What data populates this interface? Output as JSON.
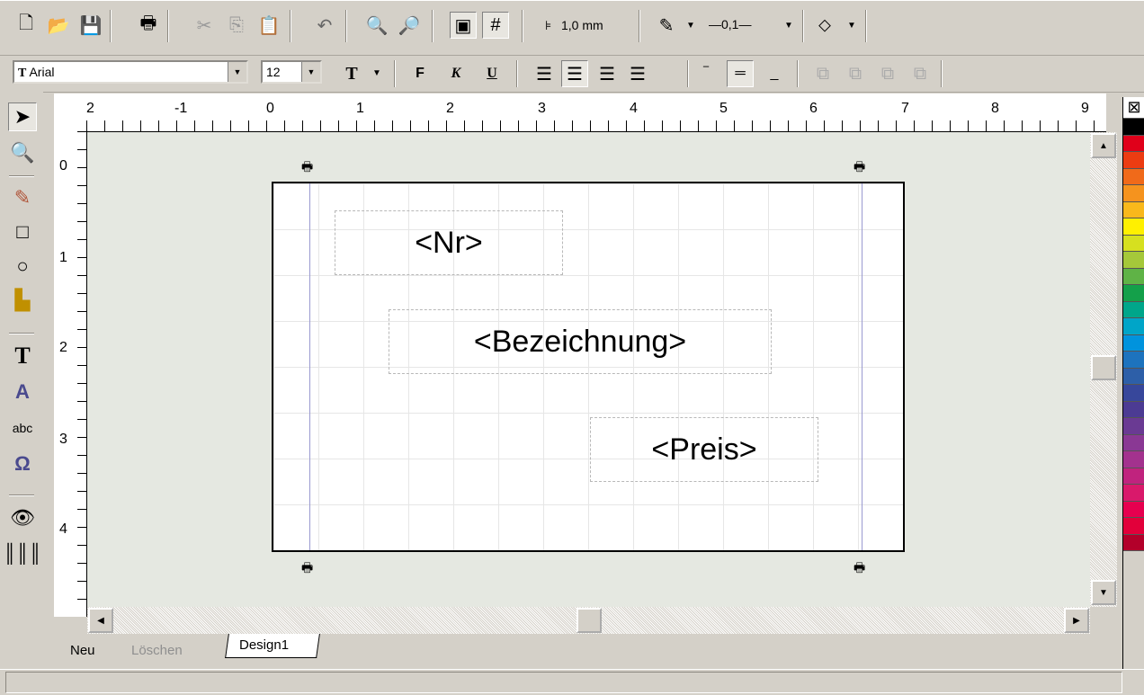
{
  "toolbar": {
    "grid_size": "1,0 mm",
    "line_width": "—0,1—"
  },
  "format": {
    "font": "Arial",
    "font_size": "12",
    "bold": "F",
    "italic": "K",
    "underline": "U"
  },
  "ruler": {
    "horizontal": [
      "2",
      "-1",
      "0",
      "1",
      "2",
      "3",
      "4",
      "5",
      "6",
      "7",
      "8",
      "9"
    ],
    "vertical": [
      "0",
      "1",
      "2",
      "3",
      "4"
    ]
  },
  "design": {
    "fields": [
      {
        "label": "<Nr>"
      },
      {
        "label": "<Bezeichnung>"
      },
      {
        "label": "<Preis>"
      }
    ]
  },
  "tabs": {
    "new_label": "Neu",
    "delete_label": "Löschen",
    "active_tab": "Design1"
  },
  "palette": {
    "colors": [
      "#000000",
      "#e0001a",
      "#ec3c12",
      "#f06a1a",
      "#f5931e",
      "#f9b81b",
      "#fff000",
      "#d6e01f",
      "#a5c83a",
      "#5fb346",
      "#14a04a",
      "#00a68a",
      "#00a5c8",
      "#0093dd",
      "#1d73be",
      "#2d5fa8",
      "#37479b",
      "#4c3b93",
      "#6a3a93",
      "#8a3894",
      "#a3328e",
      "#c0237e",
      "#d9196b",
      "#e6004f",
      "#e2003a",
      "#b3002a"
    ]
  }
}
